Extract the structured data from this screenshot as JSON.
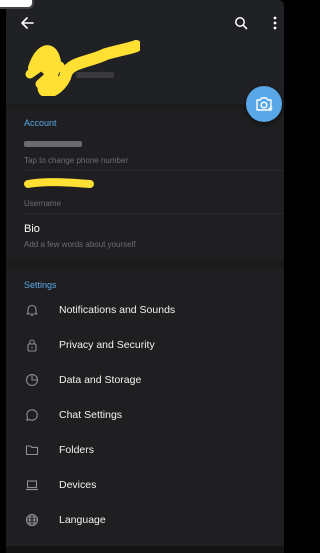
{
  "header": {
    "back_icon": "arrow-left-icon",
    "search_icon": "search-icon",
    "more_icon": "more-vertical-icon",
    "redaction_color": "#ffe033"
  },
  "fab": {
    "icon": "camera-add-icon",
    "color": "#5aa7e8"
  },
  "account": {
    "title": "Account",
    "phone_caption": "Tap to change phone number",
    "username_caption": "Username",
    "bio_label": "Bio",
    "bio_caption": "Add a few words about yourself"
  },
  "settings": {
    "title": "Settings",
    "items": [
      {
        "label": "Notifications and Sounds",
        "icon": "bell-icon"
      },
      {
        "label": "Privacy and Security",
        "icon": "lock-icon"
      },
      {
        "label": "Data and Storage",
        "icon": "pie-chart-icon"
      },
      {
        "label": "Chat Settings",
        "icon": "chat-bubble-icon"
      },
      {
        "label": "Folders",
        "icon": "folder-icon"
      },
      {
        "label": "Devices",
        "icon": "laptop-icon"
      },
      {
        "label": "Language",
        "icon": "globe-icon"
      }
    ]
  },
  "colors": {
    "accent": "#5aa7e8",
    "background": "#1b1b1b",
    "text_secondary": "#6f6f73"
  }
}
